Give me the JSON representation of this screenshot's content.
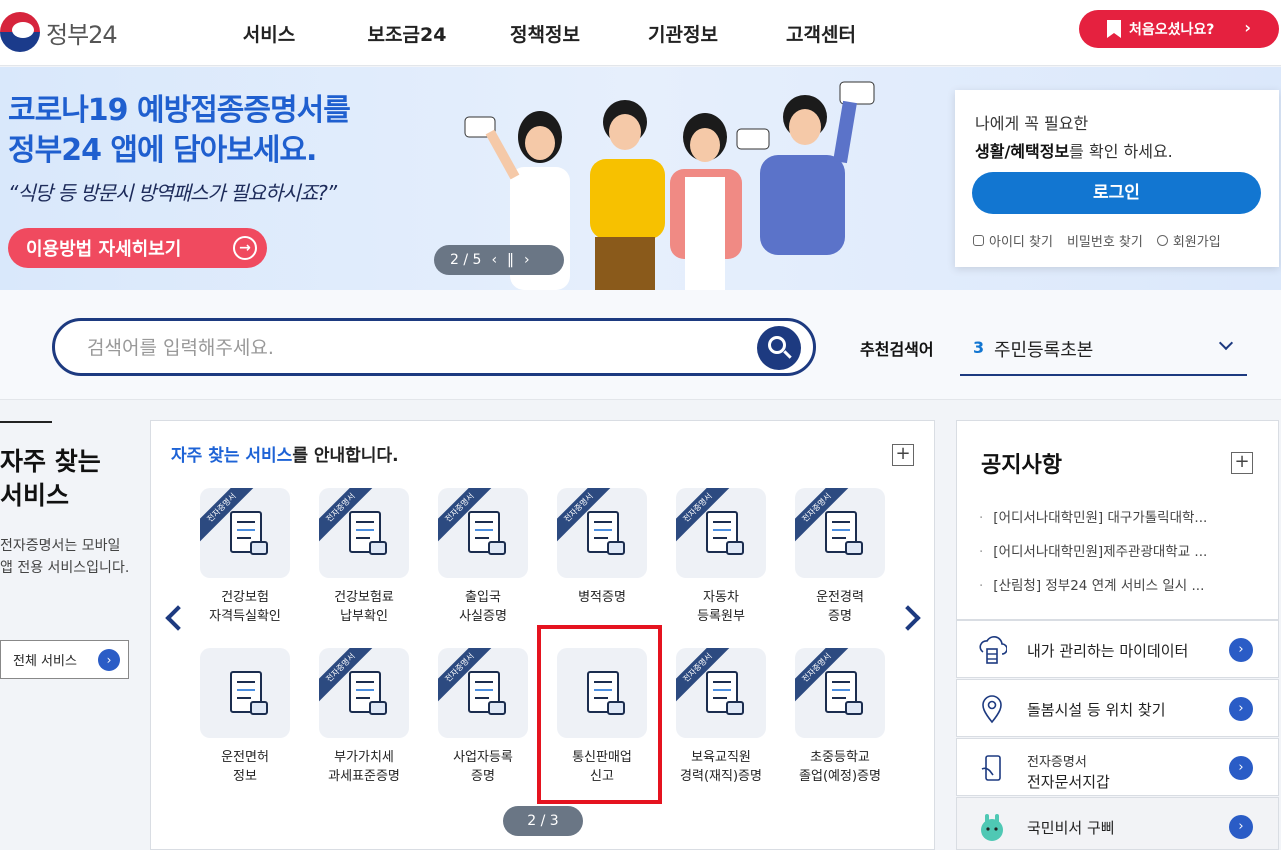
{
  "header": {
    "logo_text": "정부24",
    "nav": [
      "서비스",
      "보조금24",
      "정책정보",
      "기관정보",
      "고객센터"
    ],
    "first_visit": "처음오셨나요?"
  },
  "banner": {
    "title_line1": "코로나19 예방접종증명서를",
    "title_line2": "정부24 앱에 담아보세요.",
    "subtitle": "“식당 등 방문시 방역패스가 필요하시죠?”",
    "button": "이용방법 자세히보기",
    "pager": "2 / 5"
  },
  "login": {
    "line1": "나에게 꼭 필요한",
    "line2_bold": "생활/혜택정보",
    "line2_rest": "를 확인 하세요.",
    "button": "로그인",
    "links": [
      "아이디 찾기",
      "비밀번호 찾기",
      "회원가입"
    ]
  },
  "search": {
    "placeholder": "검색어를 입력해주세요.",
    "recommend_label": "추천검색어",
    "recommend_num": "3",
    "recommend_text": "주민등록초본"
  },
  "left_info": {
    "title": "자주 찾는 서비스",
    "desc": "전자증명서는 모바일 앱 전용 서비스입니다.",
    "all_button": "전체 서비스"
  },
  "services": {
    "head_highlight": "자주 찾는 서비스",
    "head_rest": "를 안내합니다.",
    "ribbon": "전자증명서",
    "items": [
      {
        "l1": "건강보험",
        "l2": "자격득실확인",
        "badge": true
      },
      {
        "l1": "건강보험료",
        "l2": "납부확인",
        "badge": true
      },
      {
        "l1": "출입국",
        "l2": "사실증명",
        "badge": true
      },
      {
        "l1": "병적증명",
        "l2": "",
        "badge": true
      },
      {
        "l1": "자동차",
        "l2": "등록원부",
        "badge": true
      },
      {
        "l1": "운전경력",
        "l2": "증명",
        "badge": true
      },
      {
        "l1": "운전면허",
        "l2": "정보",
        "badge": false
      },
      {
        "l1": "부가가치세",
        "l2": "과세표준증명",
        "badge": true
      },
      {
        "l1": "사업자등록",
        "l2": "증명",
        "badge": true
      },
      {
        "l1": "통신판매업",
        "l2": "신고",
        "badge": false
      },
      {
        "l1": "보육교직원",
        "l2": "경력(재직)증명",
        "badge": true
      },
      {
        "l1": "초중등학교",
        "l2": "졸업(예정)증명",
        "badge": true
      }
    ],
    "pager": "2 / 3"
  },
  "notice": {
    "title": "공지사항",
    "items": [
      "[어디서나대학민원] 대구가톨릭대학...",
      "[어디서나대학민원]제주관광대학교 ...",
      "[산림청] 정부24 연계 서비스 일시 ..."
    ]
  },
  "quick": {
    "mydata": "내가 관리하는 마이데이터",
    "care": "돌봄시설 등 위치 찾기",
    "wallet_sub": "전자증명서",
    "wallet_main": "전자문서지갑",
    "assistant": "국민비서 구삐"
  }
}
